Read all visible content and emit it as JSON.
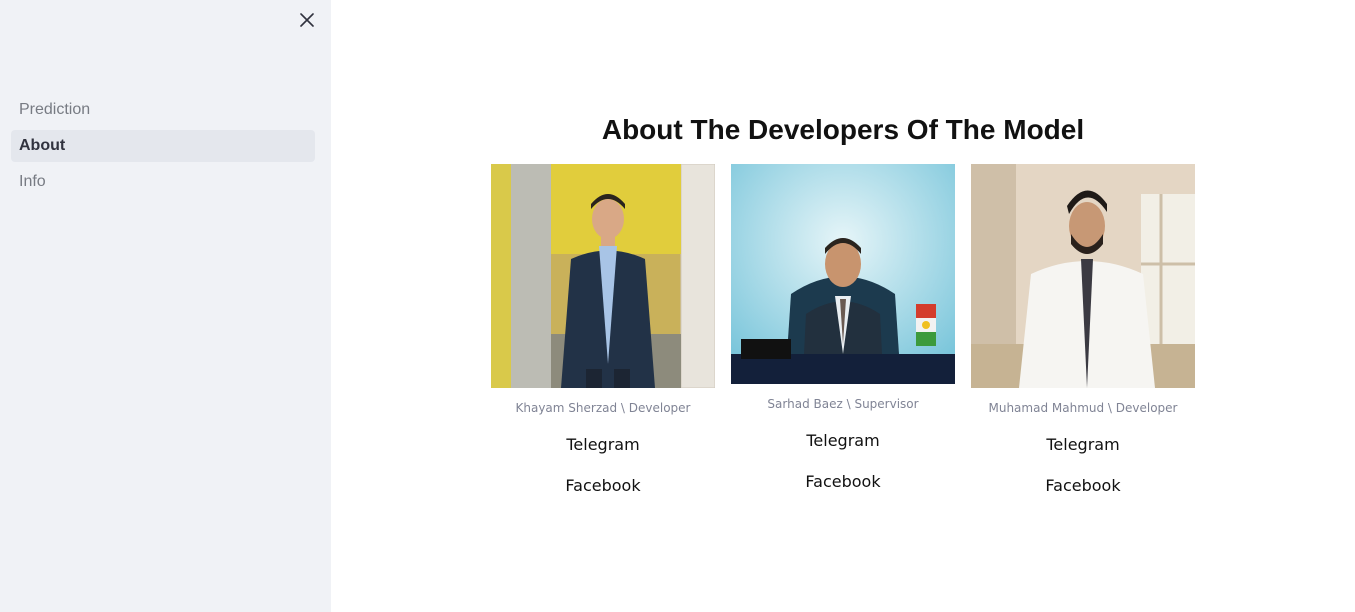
{
  "sidebar": {
    "close_icon": "close-icon",
    "items": [
      {
        "label": "Prediction",
        "active": false
      },
      {
        "label": "About",
        "active": true
      },
      {
        "label": "Info",
        "active": false
      }
    ]
  },
  "main": {
    "title": "About The Developers Of The Model",
    "developers": [
      {
        "caption": "Khayam Sherzad \\ Developer",
        "telegram": "Telegram",
        "facebook": "Facebook"
      },
      {
        "caption": "Sarhad Baez \\ Supervisor",
        "telegram": "Telegram",
        "facebook": "Facebook"
      },
      {
        "caption": "Muhamad Mahmud \\ Developer",
        "telegram": "Telegram",
        "facebook": "Facebook"
      }
    ]
  },
  "colors": {
    "sidebar_bg": "#f0f2f6",
    "active_item_bg": "#e4e7ed",
    "muted_text": "#808495"
  }
}
